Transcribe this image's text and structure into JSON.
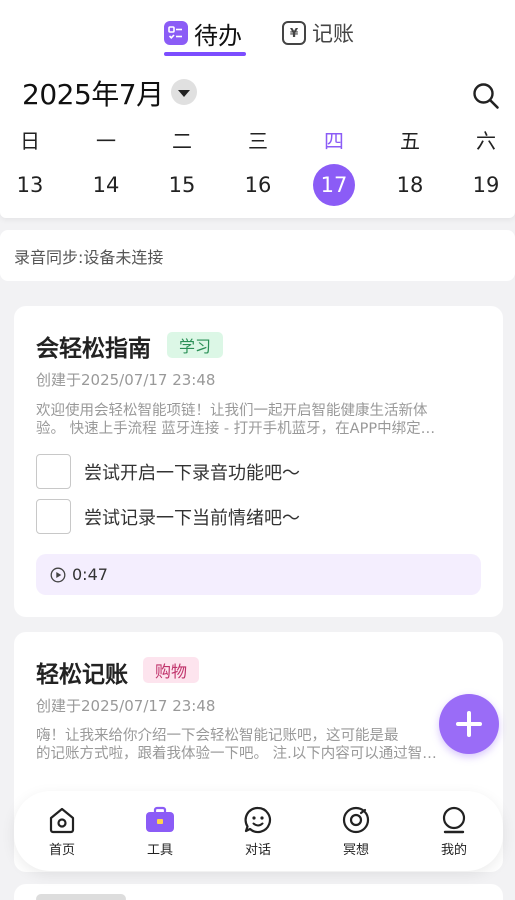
{
  "header": {
    "tabs": [
      {
        "label": "待办",
        "icon": "checklist-icon",
        "active": true
      },
      {
        "label": "记账",
        "icon": "yuan-icon",
        "active": false
      }
    ],
    "month": "2025年7月",
    "accent": "#8b5cf6"
  },
  "week": {
    "days": [
      {
        "weekday": "日",
        "date": "13"
      },
      {
        "weekday": "一",
        "date": "14"
      },
      {
        "weekday": "二",
        "date": "15"
      },
      {
        "weekday": "三",
        "date": "16"
      },
      {
        "weekday": "四",
        "date": "17",
        "selected": true
      },
      {
        "weekday": "五",
        "date": "18"
      },
      {
        "weekday": "六",
        "date": "19"
      }
    ]
  },
  "sync": {
    "text": "录音同步:设备未连接"
  },
  "cards": [
    {
      "title": "会轻松指南",
      "tag": "学习",
      "created": "创建于2025/07/17 23:48",
      "desc_line1": "欢迎使用会轻松智能项链！让我们一起开启智能健康生活新体",
      "desc_line2": "验。 快速上手流程 蓝牙连接 - 打开手机蓝牙，在APP中绑定…",
      "tasks": [
        "尝试开启一下录音功能吧～",
        "尝试记录一下当前情绪吧～"
      ],
      "audio": "0:47"
    },
    {
      "title": "轻松记账",
      "tag": "购物",
      "created": "创建于2025/07/17 23:48",
      "desc_line1": "嗨！让我来给你介绍一下会轻松智能记账吧，这可能是最",
      "desc_line2": "的记账方式啦，跟着我体验一下吧。 注.以下内容可以通过智…"
    }
  ],
  "nav": [
    {
      "label": "首页",
      "icon": "home-icon"
    },
    {
      "label": "工具",
      "icon": "toolbox-icon",
      "active": true
    },
    {
      "label": "对话",
      "icon": "chat-icon"
    },
    {
      "label": "冥想",
      "icon": "meditation-icon"
    },
    {
      "label": "我的",
      "icon": "profile-icon"
    }
  ]
}
